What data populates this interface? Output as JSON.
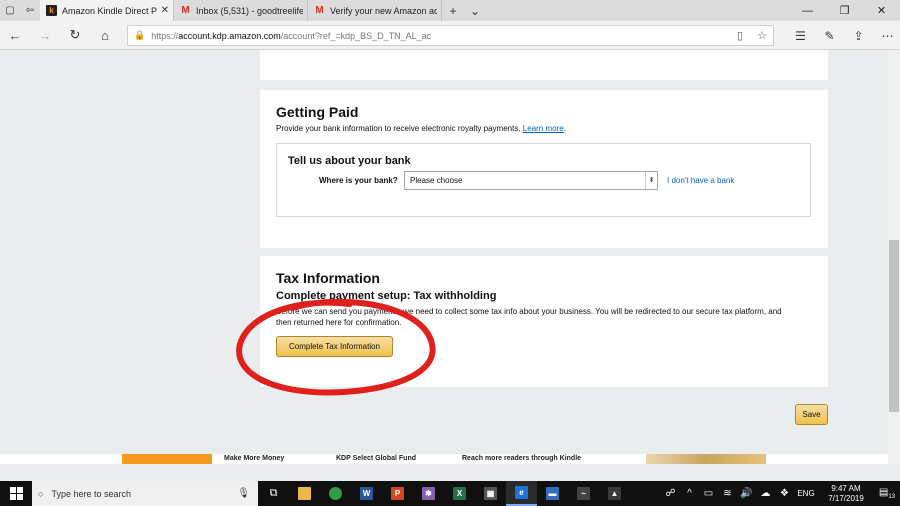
{
  "browser": {
    "tabs": [
      {
        "title": "Amazon Kindle Direct P",
        "favicon": "kindle-icon",
        "active": true
      },
      {
        "title": "Inbox (5,531) - goodtreelife",
        "favicon": "gmail-icon",
        "active": false
      },
      {
        "title": "Verify your new Amazon ac",
        "favicon": "gmail-icon",
        "active": false
      }
    ],
    "url_prefix": "https://",
    "url_domain": "account.kdp.amazon.com",
    "url_path": "/account?ref_=kdp_BS_D_TN_AL_ac"
  },
  "getting_paid": {
    "title": "Getting Paid",
    "description": "Provide your bank information to receive electronic royalty payments.",
    "learn_more": "Learn more",
    "learn_more_suffix": ".",
    "bank_section": {
      "title": "Tell us about your bank",
      "label": "Where is your bank?",
      "select_value": "Please choose",
      "no_bank_link": "I don't have a bank"
    }
  },
  "tax": {
    "title": "Tax Information",
    "subtitle": "Complete payment setup: Tax withholding",
    "description": "Before we can send you payments, we need to collect some tax info about your business. You will be redirected to our secure tax platform, and then returned here for confirmation.",
    "button": "Complete Tax Information"
  },
  "save_button": "Save",
  "promo": {
    "items": [
      "Make More Money",
      "KDP Select Global Fund",
      "Reach more readers through Kindle"
    ]
  },
  "taskbar": {
    "search_placeholder": "Type here to search",
    "language": "ENG",
    "time": "9:47 AM",
    "date": "7/17/2019",
    "notification_count": "13"
  },
  "colors": {
    "page_background": "#eaeded",
    "button_yellow": "#f0c14b",
    "link": "#0066c0",
    "annotation_red": "#e0201c",
    "taskbar": "#101010"
  }
}
